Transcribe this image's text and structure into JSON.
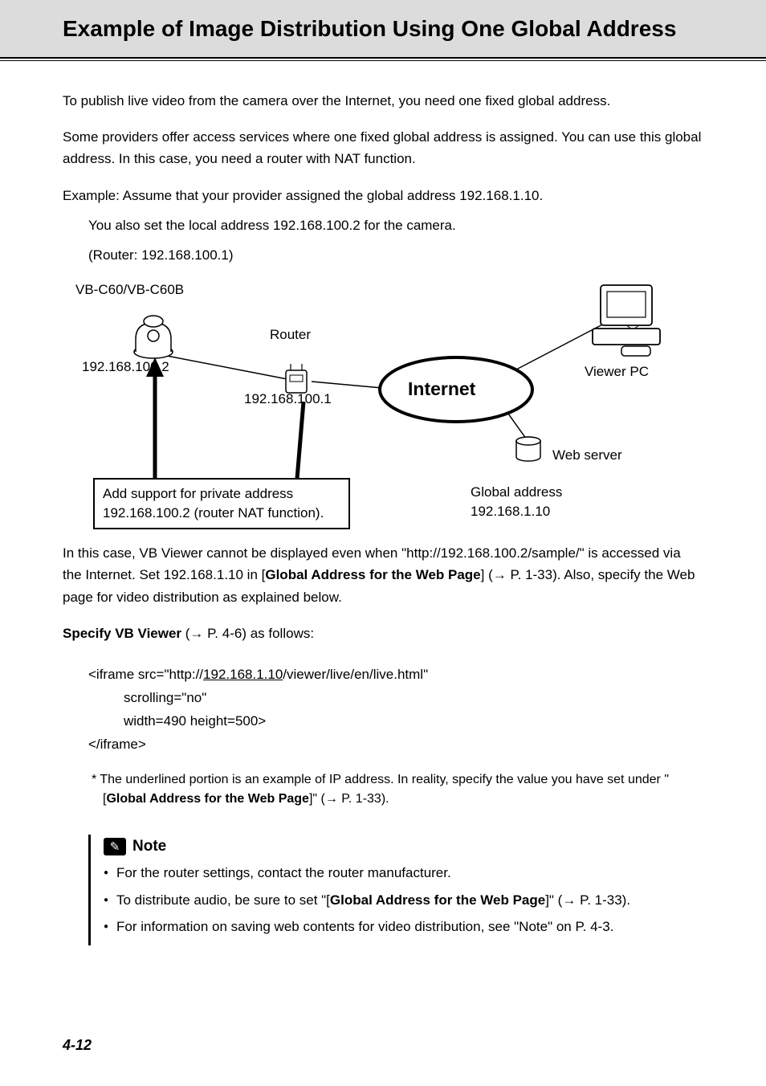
{
  "title": "Example of Image Distribution Using One Global Address",
  "paragraphs": {
    "p1": "To publish live video from the camera over the Internet, you need one fixed global address.",
    "p2": "Some providers offer access services where one fixed global address is assigned. You can use this global address. In this case, you need a router with NAT function.",
    "p3": "Example: Assume that your provider assigned the global address 192.168.1.10.",
    "p4": "You also set the local address 192.168.100.2 for the camera.",
    "p5": "(Router: 192.168.100.1)",
    "p6a": "In this case, VB Viewer cannot be displayed even when \"http://192.168.100.2/sample/\" is accessed via the Internet. Set 192.168.1.10 in [",
    "p6b": "Global Address for the Web Page",
    "p6c": "] (→ P. 1-33). Also, specify the Web page for video distribution as explained below.",
    "p7a": "Specify VB Viewer",
    "p7b": " (→ P. 4-6) as follows:"
  },
  "diagram": {
    "camera_model": "VB-C60/VB-C60B",
    "camera_ip": "192.168.100.2",
    "router_label": "Router",
    "router_ip": "192.168.100.1",
    "internet_label": "Internet",
    "viewer_pc": "Viewer PC",
    "web_server": "Web server",
    "nat_box_l1": "Add support for private address",
    "nat_box_l2": "192.168.100.2 (router NAT function).",
    "global_addr_l1": "Global address",
    "global_addr_l2": "192.168.1.10"
  },
  "code": {
    "l1a": "<iframe src=\"http://",
    "l1_ip": "192.168.1.10",
    "l1b": "/viewer/live/en/live.html\"",
    "l2": "scrolling=\"no\"",
    "l3": "width=490 height=500>",
    "l4": "</iframe>"
  },
  "asterisk": {
    "a1": "* The underlined portion is an example of IP address. In reality, specify the value you have set under \"[",
    "a2": "Global Address for the Web Page",
    "a3": "]\" (→ P. 1-33)."
  },
  "note": {
    "title": "Note",
    "items": {
      "n1": "For the router settings, contact the router manufacturer.",
      "n2a": "To distribute audio, be sure to set \"[",
      "n2b": "Global Address for the Web Page",
      "n2c": "]\" (→ P. 1-33).",
      "n3": "For information on saving web contents for video distribution, see \"Note\" on P. 4-3."
    }
  },
  "page_number": "4-12"
}
